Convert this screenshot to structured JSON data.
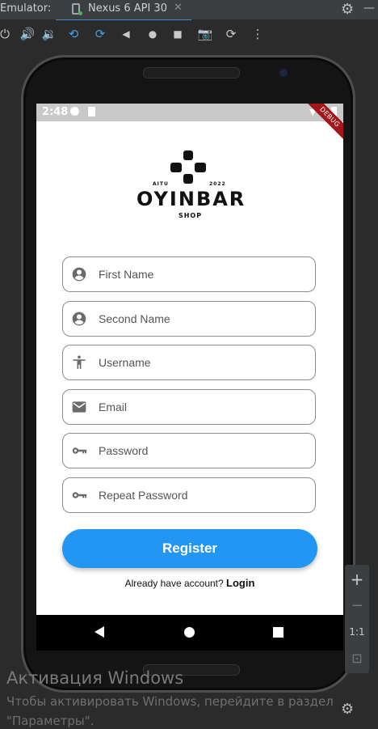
{
  "emulator": {
    "label": "Emulator:",
    "device_tab": "Nexus 6 API 30",
    "close_glyph": "✕",
    "settings_glyph": "⚙",
    "minimize_glyph": "—",
    "toolbar": [
      {
        "name": "power-icon",
        "glyph": "⏻"
      },
      {
        "name": "volume-up-icon",
        "glyph": "🔊"
      },
      {
        "name": "volume-down-icon",
        "glyph": "🔉"
      },
      {
        "name": "rotate-left-icon",
        "glyph": "⟲"
      },
      {
        "name": "rotate-right-icon",
        "glyph": "⟳"
      },
      {
        "name": "back-icon",
        "glyph": "◀"
      },
      {
        "name": "home-icon",
        "glyph": "●"
      },
      {
        "name": "overview-icon",
        "glyph": "■"
      },
      {
        "name": "camera-icon",
        "glyph": "📷"
      },
      {
        "name": "replay-icon",
        "glyph": "⟳"
      },
      {
        "name": "more-icon",
        "glyph": "⋮"
      }
    ],
    "side_panel": {
      "zoom_in": "+",
      "zoom_out": "−",
      "ratio": "1:1",
      "fit": "⊡"
    }
  },
  "status_bar": {
    "time": "2:48",
    "debug_banner": "DEBUG"
  },
  "logo": {
    "left_tag": "AITU",
    "right_tag": "2022",
    "name": "OYINBAR",
    "sub": "SHOP"
  },
  "form": {
    "fields": [
      {
        "name": "first-name-field",
        "icon": "account-circle-icon",
        "placeholder": "First Name"
      },
      {
        "name": "second-name-field",
        "icon": "account-circle-icon",
        "placeholder": "Second Name"
      },
      {
        "name": "username-field",
        "icon": "accessibility-icon",
        "placeholder": "Username"
      },
      {
        "name": "email-field",
        "icon": "mail-icon",
        "placeholder": "Email"
      },
      {
        "name": "password-field",
        "icon": "key-icon",
        "placeholder": "Password"
      },
      {
        "name": "repeat-password-field",
        "icon": "key-icon",
        "placeholder": "Repeat Password"
      }
    ],
    "register_label": "Register",
    "login_prompt": "Already have account? ",
    "login_link": "Login",
    "accent_color": "#2196f3"
  },
  "watermark": {
    "title": "Активация Windows",
    "line1": "Чтобы активировать Windows, перейдите в раздел",
    "line2": "\"Параметры\"."
  }
}
